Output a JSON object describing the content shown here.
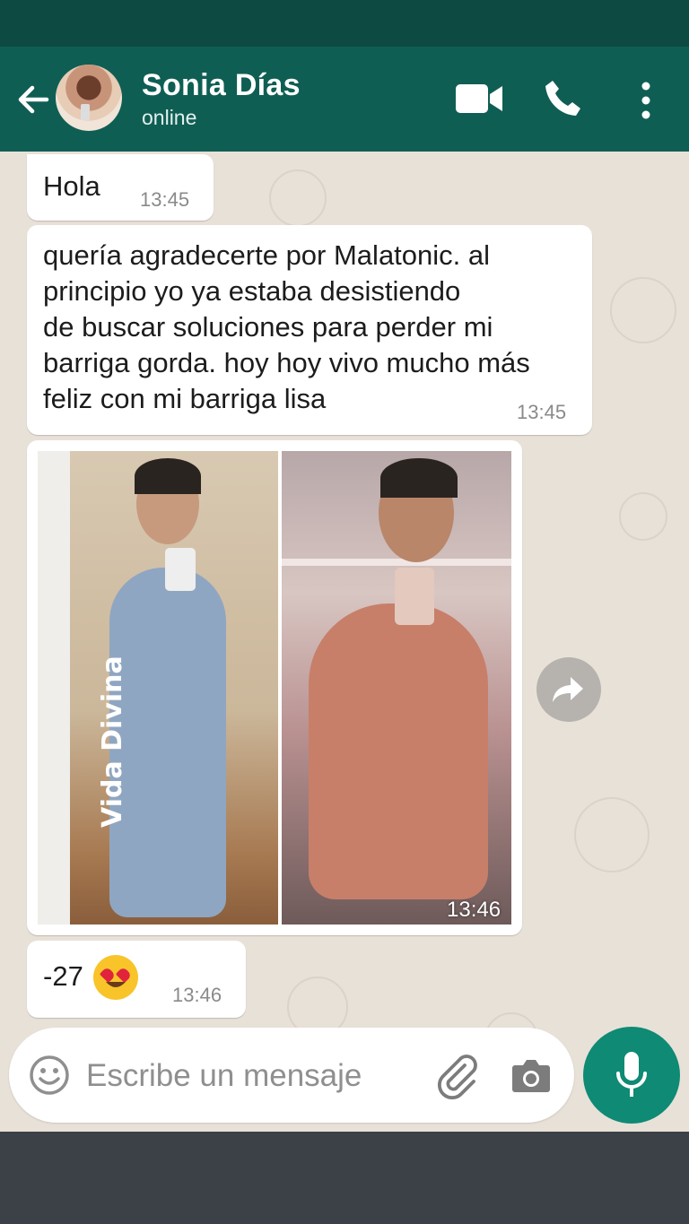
{
  "header": {
    "contact_name": "Sonia Días",
    "status": "online",
    "colors": {
      "header_bg": "#0f5e54",
      "status_bar": "#0d4a41"
    }
  },
  "messages": [
    {
      "text": "Hola",
      "time": "13:45"
    },
    {
      "text": "quería agradecerte por Malatonic. al\nprincipio yo ya estaba desistiendo\nde buscar soluciones para perder mi\nbarriga gorda. hoy hoy vivo mucho más\nfeliz con mi barriga lisa",
      "time": "13:45"
    },
    {
      "type": "image",
      "watermark": "Vida Divina",
      "time": "13:46"
    },
    {
      "text": "-27",
      "emoji": "heart-eyes-emoji",
      "time": "13:46"
    }
  ],
  "input": {
    "placeholder": "Escribe un mensaje"
  },
  "icons": [
    "back-arrow-icon",
    "video-call-icon",
    "phone-icon",
    "more-vert-icon",
    "forward-icon",
    "emoji-icon",
    "attach-icon",
    "camera-icon",
    "mic-icon"
  ]
}
